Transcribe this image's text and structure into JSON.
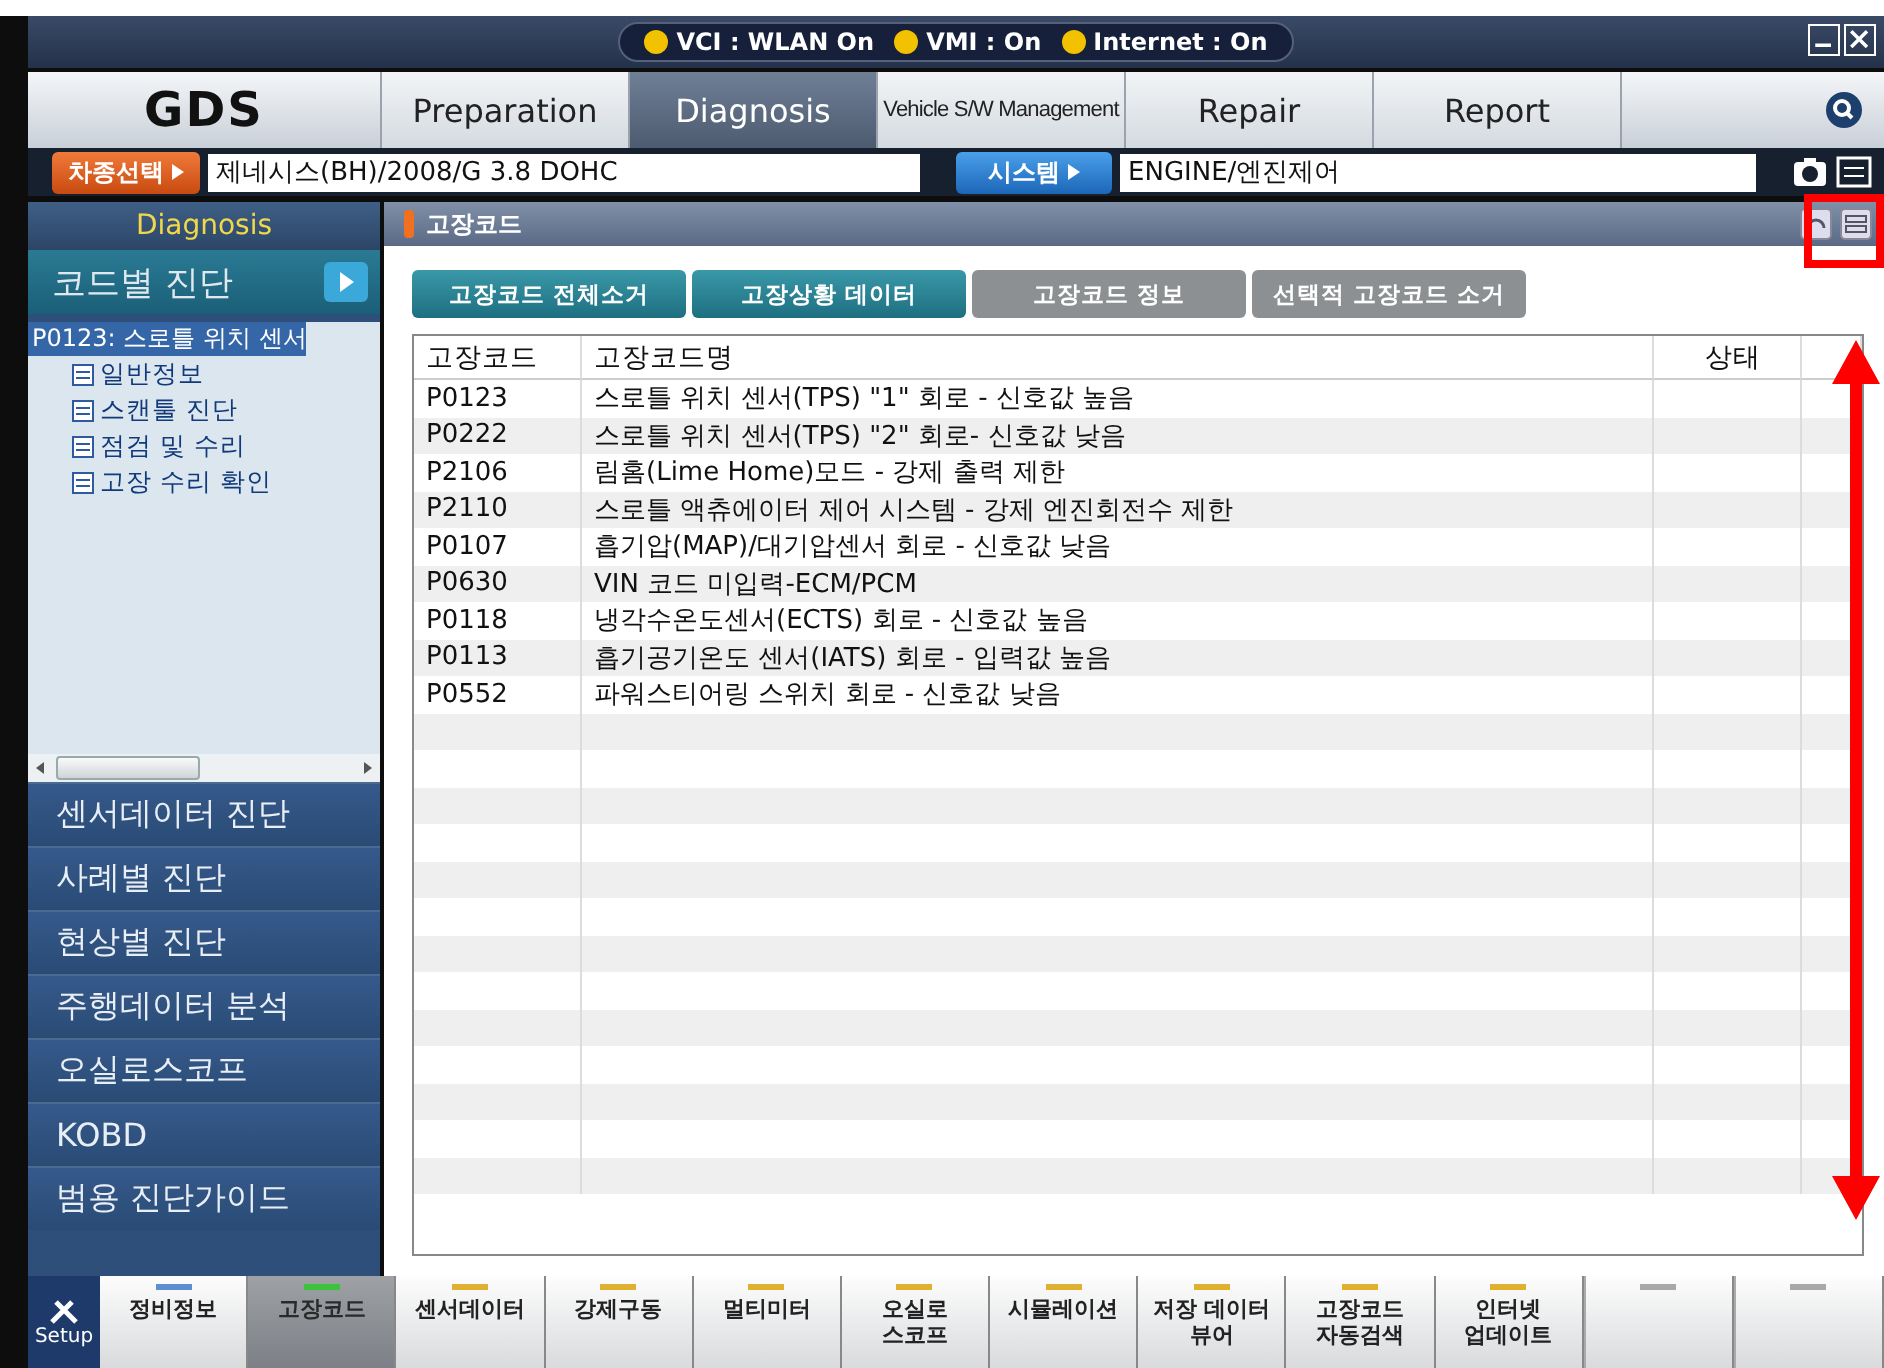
{
  "status_bar": [
    {
      "label": "VCI : WLAN On",
      "color": "#f2c200"
    },
    {
      "label": "VMI : On",
      "color": "#f2c200"
    },
    {
      "label": "Internet : On",
      "color": "#f2c200"
    }
  ],
  "logo": "GDS",
  "tabs": [
    {
      "label": "Preparation",
      "selected": false
    },
    {
      "label": "Diagnosis",
      "selected": true
    },
    {
      "label": "Vehicle S/W Management",
      "selected": false
    },
    {
      "label": "Repair",
      "selected": false
    },
    {
      "label": "Report",
      "selected": false
    }
  ],
  "vehicle": {
    "button": "차종선택",
    "value": "제네시스(BH)/2008/G 3.8 DOHC",
    "system_button": "시스템",
    "system_value": "ENGINE/엔진제어"
  },
  "sidebar": {
    "title": "Diagnosis",
    "current": "코드별 진단",
    "tree": {
      "label": "P0123: 스로틀 위치 센서",
      "children": [
        {
          "label": "일반정보"
        },
        {
          "label": "스캔툴 진단"
        },
        {
          "label": "점검 및 수리"
        },
        {
          "label": "고장 수리 확인"
        }
      ]
    },
    "items": [
      "센서데이터 진단",
      "사례별 진단",
      "현상별 진단",
      "주행데이터 분석",
      "오실로스코프",
      "KOBD",
      "범용 진단가이드"
    ]
  },
  "panel": {
    "title": "고장코드",
    "buttons": [
      {
        "label": "고장코드 전체소거",
        "disabled": false
      },
      {
        "label": "고장상황 데이터",
        "disabled": false
      },
      {
        "label": "고장코드 정보",
        "disabled": true
      },
      {
        "label": "선택적 고장코드 소거",
        "disabled": true
      }
    ],
    "table": {
      "columns": [
        "고장코드",
        "고장코드명",
        "상태"
      ],
      "rows": [
        [
          "P0123",
          "스로틀 위치 센서(TPS) \"1\" 회로 - 신호값 높음"
        ],
        [
          "P0222",
          "스로틀 위치 센서(TPS) \"2\" 회로- 신호값 낮음"
        ],
        [
          "P2106",
          "림홈(Lime Home)모드 - 강제 출력 제한"
        ],
        [
          "P2110",
          "스로틀 액츄에이터 제어 시스템 - 강제 엔진회전수 제한"
        ],
        [
          "P0107",
          "흡기압(MAP)/대기압센서 회로 - 신호값 낮음"
        ],
        [
          "P0630",
          "VIN 코드 미입력-ECM/PCM"
        ],
        [
          "P0118",
          "냉각수온도센서(ECTS) 회로 - 신호값 높음"
        ],
        [
          "P0113",
          "흡기공기온도 센서(IATS) 회로 - 입력값 높음"
        ],
        [
          "P0552",
          "파워스티어링 스위치 회로 - 신호값 낮음"
        ]
      ]
    }
  },
  "toolbar": {
    "setup": "Setup",
    "items": [
      {
        "kind": "tool",
        "label": "정비정보",
        "color": "#5b8fd0",
        "selected": false
      },
      {
        "kind": "tool",
        "label": "고장코드",
        "color": "#3bc43b",
        "selected": true
      },
      {
        "kind": "tool",
        "label": "센서데이터",
        "color": "#e0b030",
        "selected": false
      },
      {
        "kind": "tool",
        "label": "강제구동",
        "color": "#e0b030",
        "selected": false
      },
      {
        "kind": "tool",
        "label": "멀티미터",
        "color": "#e0b030",
        "selected": false
      },
      {
        "kind": "tool",
        "label": "오실로\n스코프",
        "color": "#e0b030",
        "selected": false
      },
      {
        "kind": "tool",
        "label": "시뮬레이션",
        "color": "#e0b030",
        "selected": false
      },
      {
        "kind": "tool",
        "label": "저장 데이터\n뷰어",
        "color": "#e0b030",
        "selected": false
      },
      {
        "kind": "tool",
        "label": "고장코드\n자동검색",
        "color": "#e0b030",
        "selected": false
      },
      {
        "kind": "tool",
        "label": "인터넷\n업데이트",
        "color": "#e0b030",
        "selected": false
      },
      {
        "kind": "blank",
        "color": "#a8a8a8"
      },
      {
        "kind": "blank",
        "color": "#a8a8a8"
      }
    ]
  },
  "annotations": {
    "highlight_box": true,
    "range_arrow": true
  }
}
